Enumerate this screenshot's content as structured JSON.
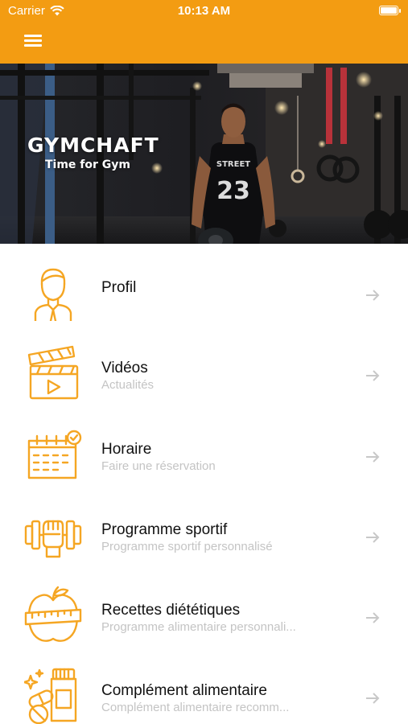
{
  "status_bar": {
    "carrier": "Carrier",
    "time": "10:13 AM",
    "battery_level": 1.0
  },
  "colors": {
    "accent": "#f39c12",
    "icon_orange": "#f5a623",
    "subtitle_gray": "#c4c4c4",
    "arrow_gray": "#c8c8c8"
  },
  "nav_bar": {
    "menu_icon": "hamburger-menu-icon"
  },
  "hero": {
    "title": "GYMCHAFT",
    "subtitle": "Time for Gym",
    "jersey_text": "STREET",
    "jersey_number": "23"
  },
  "menu": {
    "items": [
      {
        "icon": "profile-person-icon",
        "title": "Profil",
        "subtitle": ""
      },
      {
        "icon": "clapperboard-video-icon",
        "title": "Vidéos",
        "subtitle": "Actualités"
      },
      {
        "icon": "calendar-check-icon",
        "title": "Horaire",
        "subtitle": "Faire une réservation"
      },
      {
        "icon": "dumbbell-fist-icon",
        "title": "Programme sportif",
        "subtitle": "Programme sportif personnalisé"
      },
      {
        "icon": "apple-measuring-tape-icon",
        "title": "Recettes diététiques",
        "subtitle": "Programme alimentaire personnali..."
      },
      {
        "icon": "supplement-pills-icon",
        "title": "Complément alimentaire",
        "subtitle": "Complément alimentaire recomm..."
      }
    ]
  }
}
